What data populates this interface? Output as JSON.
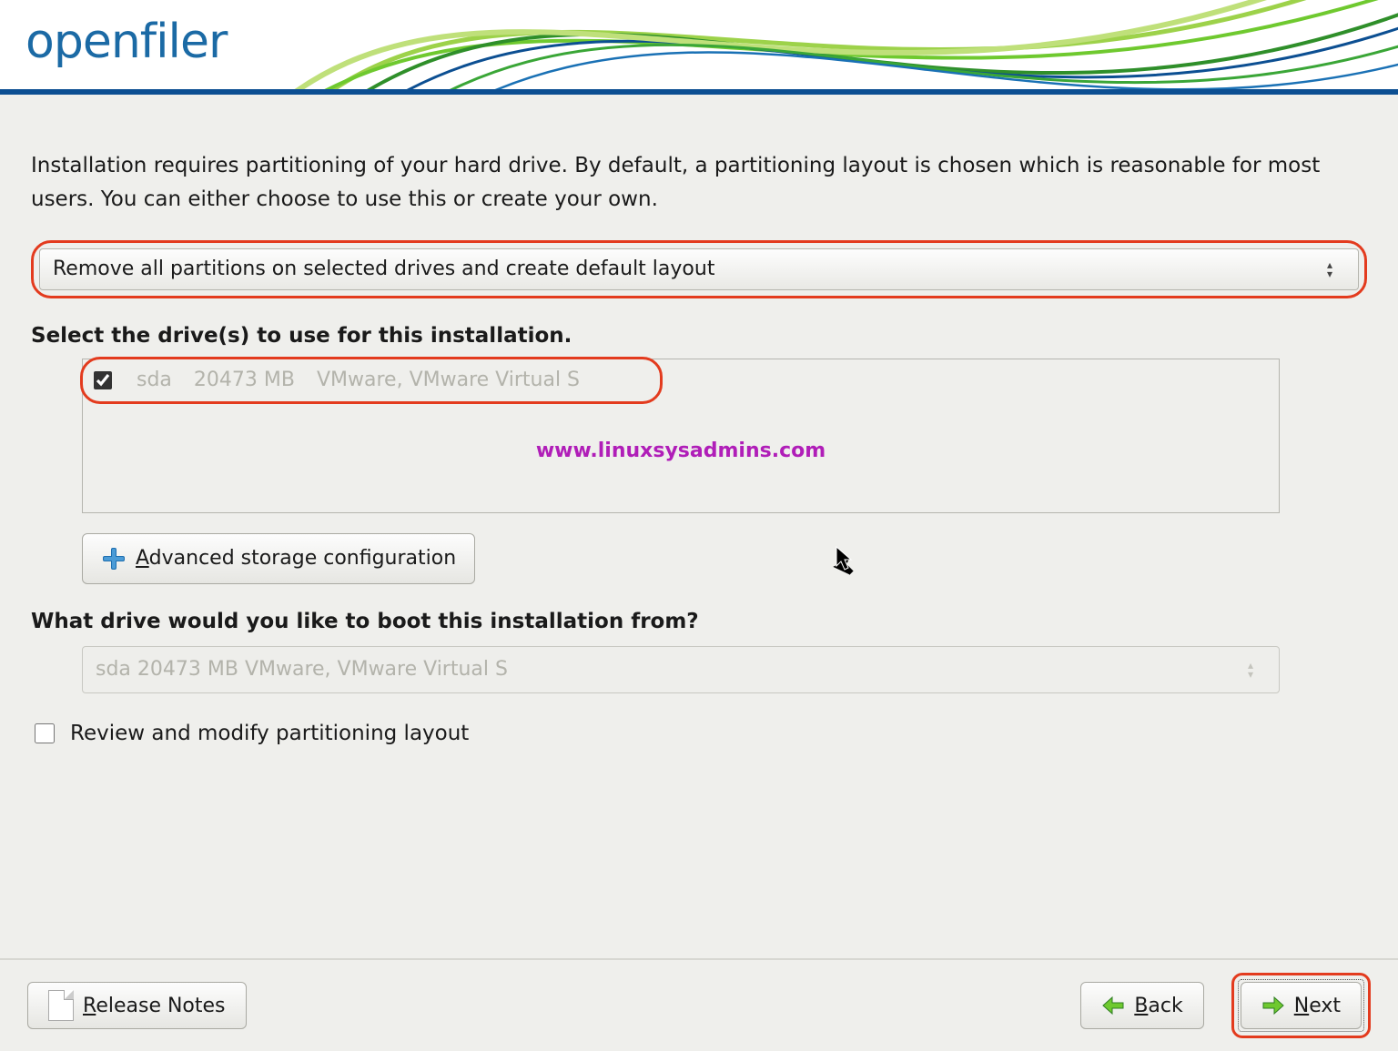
{
  "brand": "openfiler",
  "intro_text": "Installation requires partitioning of your hard drive.  By default, a partitioning layout is chosen which is reasonable for most users. You can either choose to use this or create your own.",
  "partition_layout": {
    "selected": "Remove all partitions on selected drives and create default layout"
  },
  "drive_select": {
    "label": "Select the drive(s) to use for this installation.",
    "items": [
      {
        "checked": true,
        "name": "sda",
        "size": "20473 MB",
        "model": "VMware, VMware Virtual S"
      }
    ]
  },
  "watermark": "www.linuxsysadmins.com",
  "adv_storage": {
    "prefix": "A",
    "rest": "dvanced storage configuration"
  },
  "boot_drive": {
    "label": "What drive would you like to boot this installation from?",
    "selected": "sda    20473 MB VMware, VMware Virtual S"
  },
  "review": {
    "prefix": "Re",
    "u": "v",
    "rest": "iew and modify partitioning layout",
    "checked": false
  },
  "footer": {
    "release_notes": {
      "u": "R",
      "rest": "elease Notes"
    },
    "back": {
      "u": "B",
      "rest": "ack"
    },
    "next": {
      "u": "N",
      "rest": "ext"
    }
  }
}
